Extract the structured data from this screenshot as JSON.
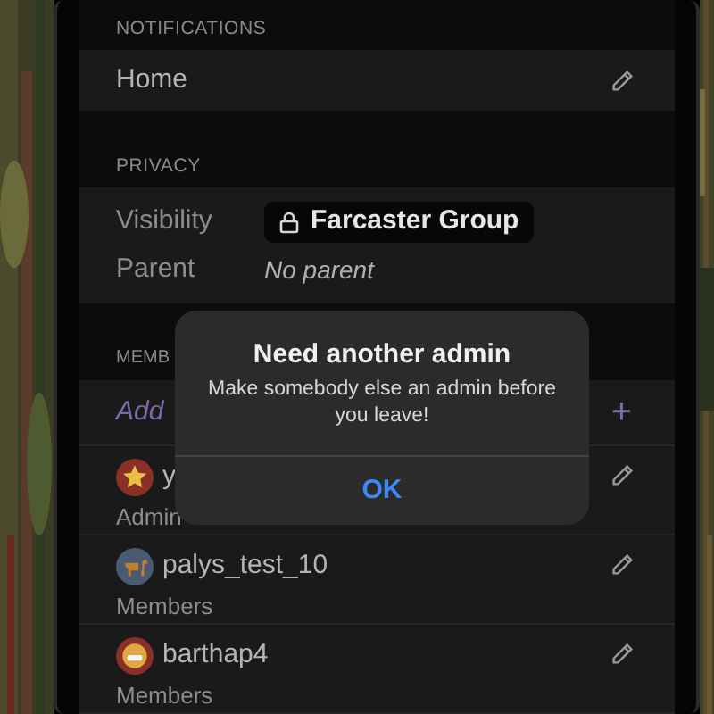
{
  "notifications": {
    "header": "NOTIFICATIONS",
    "rows": [
      {
        "label": "Home"
      }
    ]
  },
  "privacy": {
    "header": "PRIVACY",
    "visibility_label": "Visibility",
    "visibility_value": "Farcaster Group",
    "parent_label": "Parent",
    "parent_value": "No parent"
  },
  "members": {
    "header": "MEMB",
    "add_label": "Add",
    "add_button": "+",
    "rows": [
      {
        "name": "y",
        "role": "Admin",
        "kind": "star"
      },
      {
        "name": "palys_test_10",
        "role": "Members",
        "kind": "dog"
      },
      {
        "name": "barthap4",
        "role": "Members",
        "kind": "grin"
      }
    ]
  },
  "alert": {
    "title": "Need another admin",
    "message": "Make somebody else an admin before you leave!",
    "button": "OK"
  }
}
